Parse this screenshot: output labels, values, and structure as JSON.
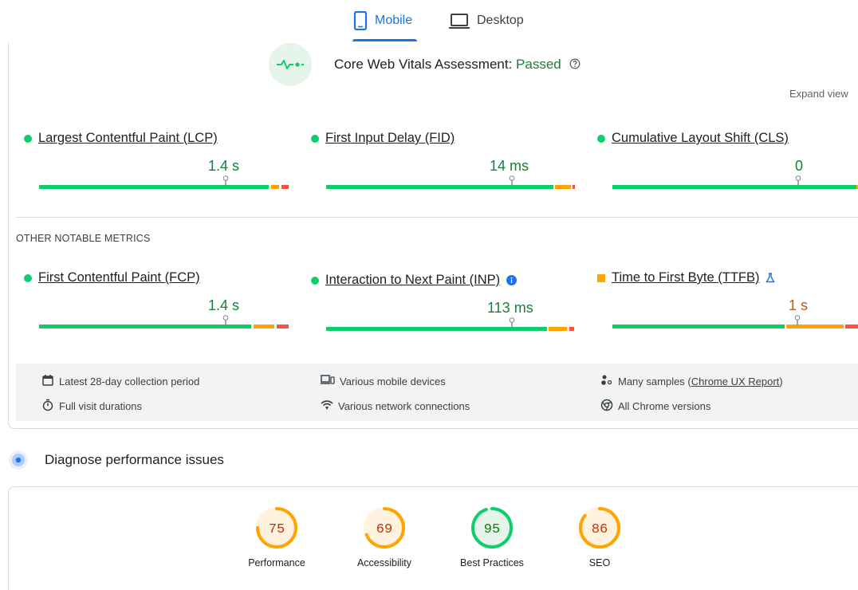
{
  "tabs": {
    "mobile": "Mobile",
    "desktop": "Desktop"
  },
  "cwv": {
    "prefix": "Core Web Vitals Assessment: ",
    "status": "Passed"
  },
  "expand_view": "Expand view",
  "core_metrics": [
    {
      "name": "Largest Contentful Paint (LCP)",
      "value": "1.4 s",
      "status": "good"
    },
    {
      "name": "First Input Delay (FID)",
      "value": "14 ms",
      "status": "good"
    },
    {
      "name": "Cumulative Layout Shift (CLS)",
      "value": "0",
      "status": "good"
    }
  ],
  "other_metrics_title": "OTHER NOTABLE METRICS",
  "other_metrics": [
    {
      "name": "First Contentful Paint (FCP)",
      "value": "1.4 s",
      "status": "good"
    },
    {
      "name": "Interaction to Next Paint (INP)",
      "value": "113 ms",
      "status": "good"
    },
    {
      "name": "Time to First Byte (TTFB)",
      "value": "1 s",
      "status": "needs-improvement"
    }
  ],
  "info": {
    "collection_period": "Latest 28-day collection period",
    "visit_durations": "Full visit durations",
    "devices": "Various mobile devices",
    "network": "Various network connections",
    "samples_prefix": "Many samples (",
    "samples_link": "Chrome UX Report",
    "samples_suffix": ")",
    "chrome_versions": "All Chrome versions"
  },
  "diagnose_title": "Diagnose performance issues",
  "scores": [
    {
      "label": "Performance",
      "value": "75",
      "score": 75,
      "color": "#ffa400",
      "bg": "#fff3e0",
      "text": "#c33300"
    },
    {
      "label": "Accessibility",
      "value": "69",
      "score": 69,
      "color": "#ffa400",
      "bg": "#fff3e0",
      "text": "#c33300"
    },
    {
      "label": "Best Practices",
      "value": "95",
      "score": 95,
      "color": "#0cce6b",
      "bg": "#e6f4ea",
      "text": "#008800"
    },
    {
      "label": "SEO",
      "value": "86",
      "score": 86,
      "color": "#ffa400",
      "bg": "#fff3e0",
      "text": "#c33300"
    }
  ],
  "colors": {
    "accent": "#1a73e8",
    "good": "#0cce6b",
    "needs_improvement": "#ffa400",
    "poor": "#ff4e42"
  }
}
